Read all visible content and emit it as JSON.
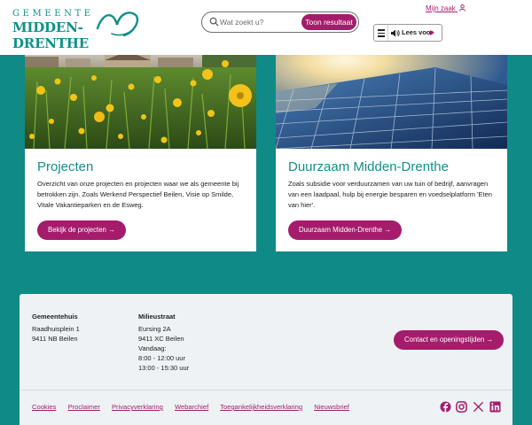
{
  "header": {
    "logo": {
      "line1": "GEMEENTE",
      "line2": "MIDDEN-DRENTHE"
    },
    "search": {
      "placeholder": "Wat zoekt u?",
      "button": "Toon resultaat"
    },
    "mijn_zaak": "Mijn zaak",
    "read_aloud": "Lees voor"
  },
  "cards": [
    {
      "title": "Projecten",
      "text": "Overzicht van onze projecten en projecten waar we als gemeente bij betrokken zijn. Zoals Werkend Perspectief Beilen, Visie op Smilde, Vitale Vakantieparken en de Esweg.",
      "button": "Bekijk de projecten →"
    },
    {
      "title": "Duurzaam Midden-Drenthe",
      "text": "Zoals subsidie voor verduurzamen van uw tuin of bedrijf, aanvragen van een laadpaal, hulp bij energie besparen en voedselplatform 'Eten van hier'.",
      "button": "Duurzaam Midden-Drenthe →"
    }
  ],
  "footer": {
    "gemeentehuis": {
      "title": "Gemeentehuis",
      "line1": "Raadhuisplein 1",
      "line2": "9411 NB Beilen"
    },
    "milieustraat": {
      "title": "Milieustraat",
      "line1": "Eursing 2A",
      "line2": "9411 XC Beilen",
      "line3": "Vandaag:",
      "line4": "8:00 - 12:00 uur",
      "line5": "13:00 - 15:30 uur"
    },
    "contact_button": "Contact en openingstijden →",
    "links": [
      "Cookies",
      "Proclaimer",
      "Privacyverklaring",
      "Webarchief",
      "Toegankelijkheidsverklaring",
      "Nieuwsbrief"
    ],
    "social": [
      "facebook-icon",
      "instagram-icon",
      "x-icon",
      "linkedin-icon"
    ]
  },
  "colors": {
    "teal": "#10908a",
    "background": "#0f8a86",
    "magenta": "#a51c6c",
    "footer_bg": "#eef2f4"
  }
}
